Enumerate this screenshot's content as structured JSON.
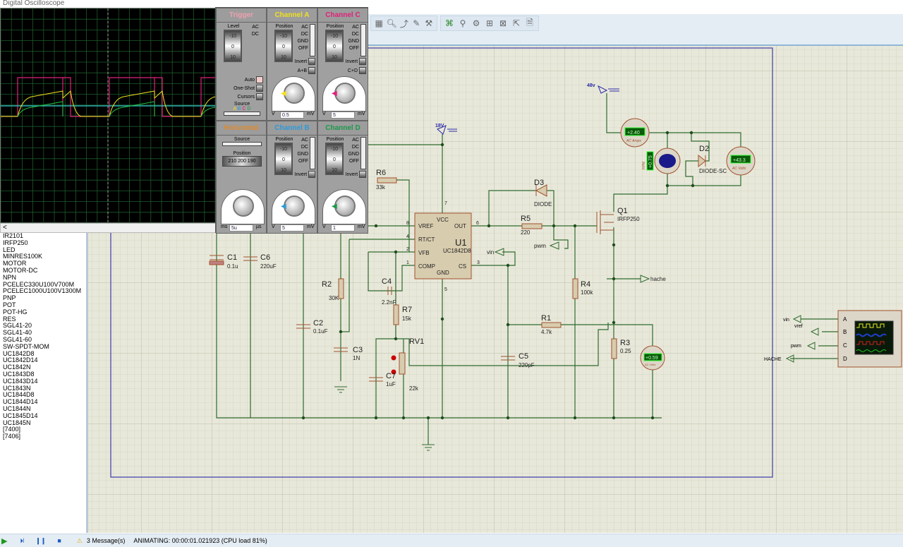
{
  "oscilloscope": {
    "title": "Digital Oscilloscope",
    "scroll_left": "<",
    "trigger": {
      "title": "Trigger",
      "level_label": "Level",
      "coupling": [
        "AC",
        "DC"
      ],
      "drum": [
        "-10",
        "0",
        "10"
      ],
      "auto": "Auto",
      "one_shot": "One-Shot",
      "cursors": "Cursors",
      "source_label": "Source",
      "sources": [
        "A",
        "B",
        "C",
        "D"
      ]
    },
    "horizontal": {
      "title": "Horizontal",
      "source_label": "Source",
      "position_label": "Position",
      "position_scale": [
        "210",
        "200",
        "190"
      ],
      "value": "5u",
      "unit_left": "ms",
      "unit_right": "µs"
    },
    "channels": [
      {
        "title": "Channel A",
        "color": "#f0e020",
        "position_label": "Position",
        "coupling": [
          "AC",
          "DC",
          "GND",
          "OFF"
        ],
        "invert": "Invert",
        "combine": "A+B",
        "value": "0.5",
        "unit_left": "V",
        "unit_right": "mV"
      },
      {
        "title": "Channel C",
        "color": "#e0207a",
        "position_label": "Position",
        "coupling": [
          "AC",
          "DC",
          "GND",
          "OFF"
        ],
        "invert": "Invert",
        "combine": "C+D",
        "value": "5",
        "unit_left": "V",
        "unit_right": "mV"
      },
      {
        "title": "Channel B",
        "color": "#2c9ad8",
        "position_label": "Position",
        "coupling": [
          "AC",
          "DC",
          "GND",
          "OFF"
        ],
        "invert": "Invert",
        "value": "5",
        "unit_left": "V",
        "unit_right": "mV"
      },
      {
        "title": "Channel D",
        "color": "#1a9a4a",
        "position_label": "Position",
        "coupling": [
          "AC",
          "DC",
          "GND",
          "OFF"
        ],
        "invert": "Invert",
        "value": "1",
        "unit_left": "V",
        "unit_right": "mV"
      }
    ],
    "horizontal_color": "#e08a2a",
    "trigger_color": "#f0a0b0",
    "drum_values": [
      "-10",
      "0",
      "10"
    ]
  },
  "device_list": {
    "items": [
      "IR2101",
      "IRFP250",
      "LED",
      "MINRES100K",
      "MOTOR",
      "MOTOR-DC",
      "NPN",
      "PCELEC330U100V700M",
      "PCELEC1000U100V1300M",
      "PNP",
      "POT",
      "POT-HG",
      "RES",
      "SGL41-20",
      "SGL41-40",
      "SGL41-60",
      "SW-SPDT-MOM",
      "UC1842D8",
      "UC1842D14",
      "UC1842N",
      "UC1843D8",
      "UC1843D14",
      "UC1843N",
      "UC1844D8",
      "UC1844D14",
      "UC1844N",
      "UC1845D14",
      "UC1845N",
      "[7400]",
      "[7406]"
    ]
  },
  "toolbar": {
    "icons": [
      "zoom-area-icon",
      "zoom-icon",
      "wire-autorouter-icon",
      "search-tag-icon",
      "property-tool-icon",
      "netlist-icon",
      "search-icon",
      "design-explorer-icon",
      "new-sheet-icon",
      "remove-sheet-icon",
      "exit-to-parent-icon",
      "bom-icon"
    ]
  },
  "schematic": {
    "power": {
      "v18": "18V",
      "v48": "48v"
    },
    "U1": {
      "ref": "U1",
      "part": "UC1842D8",
      "pins": {
        "vref": "VREF",
        "rtct": "RT/CT",
        "vfb": "VFB",
        "comp": "COMP",
        "vcc": "VCC",
        "out": "OUT",
        "cs": "CS",
        "gnd": "GND"
      },
      "pin_numbers": {
        "vref": "8",
        "rtct": "4",
        "vfb": "2",
        "comp": "1",
        "vcc": "7",
        "out": "6",
        "cs": "3",
        "gnd": "5"
      }
    },
    "components": {
      "R6": {
        "ref": "R6",
        "value": "33k"
      },
      "R5": {
        "ref": "R5",
        "value": "220"
      },
      "R2": {
        "ref": "R2",
        "value": "30K"
      },
      "R7": {
        "ref": "R7",
        "value": "15k"
      },
      "R4": {
        "ref": "R4",
        "value": "100k"
      },
      "R1": {
        "ref": "R1",
        "value": "4.7k"
      },
      "R3": {
        "ref": "R3",
        "value": "0.25"
      },
      "RV1": {
        "ref": "RV1",
        "value": "22k"
      },
      "C1": {
        "ref": "C1",
        "value": "0.1u"
      },
      "C6": {
        "ref": "C6",
        "value": "220uF"
      },
      "C2": {
        "ref": "C2",
        "value": "0.1uF"
      },
      "C3": {
        "ref": "C3",
        "value": "1N"
      },
      "C4": {
        "ref": "C4",
        "value": "2.2nF"
      },
      "C5": {
        "ref": "C5",
        "value": "220pF"
      },
      "C7": {
        "ref": "C7",
        "value": "1uF"
      },
      "D3": {
        "ref": "D3",
        "value": "DIODE"
      },
      "D2": {
        "ref": "D2",
        "value": "DIODE-SC"
      },
      "Q1": {
        "ref": "Q1",
        "value": "IRFP250"
      }
    },
    "terminals": {
      "pwm": "pwm",
      "vin": "vin",
      "hache": "hache"
    },
    "meters": {
      "ammeter": {
        "reading": "+2.40",
        "label": "AC Amps"
      },
      "voltmeter_load": {
        "reading": "+43.3",
        "label": "AC Volts"
      },
      "voltmeter_sense": {
        "reading": "+0.59",
        "label": "AC Volts"
      },
      "motor": {
        "reading": "+0.75",
        "label": "RPM"
      }
    },
    "scope_block": {
      "inputs": [
        "A",
        "B",
        "C",
        "D"
      ],
      "nets": {
        "vin": "vin",
        "vref": "vref",
        "pwm": "pwm",
        "hache": "HACHE"
      }
    },
    "colors": {
      "wire": "#2e6b2e",
      "component": "#a0522d",
      "grid_bg": "#e8e8da",
      "border": "#3a3aa8"
    }
  },
  "statusbar": {
    "messages": "3 Message(s)",
    "status": "ANIMATING: 00:00:01.021923 (CPU load 81%)"
  }
}
